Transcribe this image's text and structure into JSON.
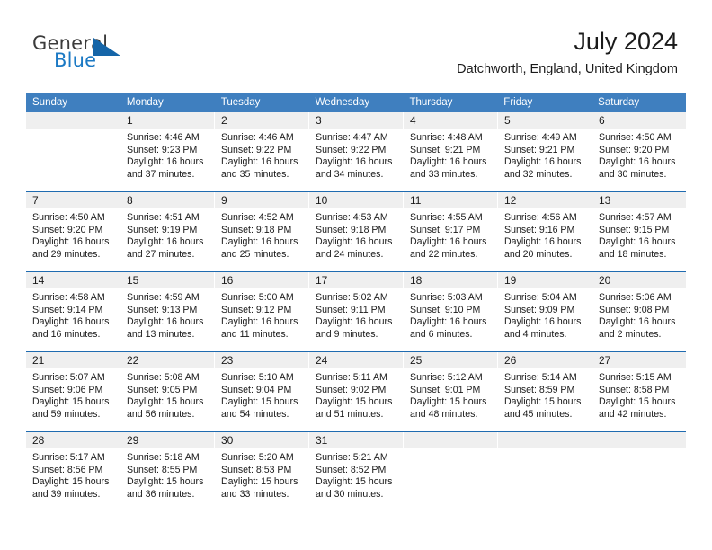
{
  "brand": {
    "name_part1": "General",
    "name_part2": "Blue",
    "accent_color": "#1b79c4",
    "triangle_color": "#1565a8"
  },
  "header": {
    "month_title": "July 2024",
    "location": "Datchworth, England, United Kingdom"
  },
  "theme": {
    "header_blue": "#3f7fbf",
    "separator_blue": "#1f6bb0",
    "day_band_gray": "#efefef"
  },
  "weekdays": [
    "Sunday",
    "Monday",
    "Tuesday",
    "Wednesday",
    "Thursday",
    "Friday",
    "Saturday"
  ],
  "weeks": [
    [
      {
        "day": "",
        "lines": []
      },
      {
        "day": "1",
        "lines": [
          "Sunrise: 4:46 AM",
          "Sunset: 9:23 PM",
          "Daylight: 16 hours",
          "and 37 minutes."
        ]
      },
      {
        "day": "2",
        "lines": [
          "Sunrise: 4:46 AM",
          "Sunset: 9:22 PM",
          "Daylight: 16 hours",
          "and 35 minutes."
        ]
      },
      {
        "day": "3",
        "lines": [
          "Sunrise: 4:47 AM",
          "Sunset: 9:22 PM",
          "Daylight: 16 hours",
          "and 34 minutes."
        ]
      },
      {
        "day": "4",
        "lines": [
          "Sunrise: 4:48 AM",
          "Sunset: 9:21 PM",
          "Daylight: 16 hours",
          "and 33 minutes."
        ]
      },
      {
        "day": "5",
        "lines": [
          "Sunrise: 4:49 AM",
          "Sunset: 9:21 PM",
          "Daylight: 16 hours",
          "and 32 minutes."
        ]
      },
      {
        "day": "6",
        "lines": [
          "Sunrise: 4:50 AM",
          "Sunset: 9:20 PM",
          "Daylight: 16 hours",
          "and 30 minutes."
        ]
      }
    ],
    [
      {
        "day": "7",
        "lines": [
          "Sunrise: 4:50 AM",
          "Sunset: 9:20 PM",
          "Daylight: 16 hours",
          "and 29 minutes."
        ]
      },
      {
        "day": "8",
        "lines": [
          "Sunrise: 4:51 AM",
          "Sunset: 9:19 PM",
          "Daylight: 16 hours",
          "and 27 minutes."
        ]
      },
      {
        "day": "9",
        "lines": [
          "Sunrise: 4:52 AM",
          "Sunset: 9:18 PM",
          "Daylight: 16 hours",
          "and 25 minutes."
        ]
      },
      {
        "day": "10",
        "lines": [
          "Sunrise: 4:53 AM",
          "Sunset: 9:18 PM",
          "Daylight: 16 hours",
          "and 24 minutes."
        ]
      },
      {
        "day": "11",
        "lines": [
          "Sunrise: 4:55 AM",
          "Sunset: 9:17 PM",
          "Daylight: 16 hours",
          "and 22 minutes."
        ]
      },
      {
        "day": "12",
        "lines": [
          "Sunrise: 4:56 AM",
          "Sunset: 9:16 PM",
          "Daylight: 16 hours",
          "and 20 minutes."
        ]
      },
      {
        "day": "13",
        "lines": [
          "Sunrise: 4:57 AM",
          "Sunset: 9:15 PM",
          "Daylight: 16 hours",
          "and 18 minutes."
        ]
      }
    ],
    [
      {
        "day": "14",
        "lines": [
          "Sunrise: 4:58 AM",
          "Sunset: 9:14 PM",
          "Daylight: 16 hours",
          "and 16 minutes."
        ]
      },
      {
        "day": "15",
        "lines": [
          "Sunrise: 4:59 AM",
          "Sunset: 9:13 PM",
          "Daylight: 16 hours",
          "and 13 minutes."
        ]
      },
      {
        "day": "16",
        "lines": [
          "Sunrise: 5:00 AM",
          "Sunset: 9:12 PM",
          "Daylight: 16 hours",
          "and 11 minutes."
        ]
      },
      {
        "day": "17",
        "lines": [
          "Sunrise: 5:02 AM",
          "Sunset: 9:11 PM",
          "Daylight: 16 hours",
          "and 9 minutes."
        ]
      },
      {
        "day": "18",
        "lines": [
          "Sunrise: 5:03 AM",
          "Sunset: 9:10 PM",
          "Daylight: 16 hours",
          "and 6 minutes."
        ]
      },
      {
        "day": "19",
        "lines": [
          "Sunrise: 5:04 AM",
          "Sunset: 9:09 PM",
          "Daylight: 16 hours",
          "and 4 minutes."
        ]
      },
      {
        "day": "20",
        "lines": [
          "Sunrise: 5:06 AM",
          "Sunset: 9:08 PM",
          "Daylight: 16 hours",
          "and 2 minutes."
        ]
      }
    ],
    [
      {
        "day": "21",
        "lines": [
          "Sunrise: 5:07 AM",
          "Sunset: 9:06 PM",
          "Daylight: 15 hours",
          "and 59 minutes."
        ]
      },
      {
        "day": "22",
        "lines": [
          "Sunrise: 5:08 AM",
          "Sunset: 9:05 PM",
          "Daylight: 15 hours",
          "and 56 minutes."
        ]
      },
      {
        "day": "23",
        "lines": [
          "Sunrise: 5:10 AM",
          "Sunset: 9:04 PM",
          "Daylight: 15 hours",
          "and 54 minutes."
        ]
      },
      {
        "day": "24",
        "lines": [
          "Sunrise: 5:11 AM",
          "Sunset: 9:02 PM",
          "Daylight: 15 hours",
          "and 51 minutes."
        ]
      },
      {
        "day": "25",
        "lines": [
          "Sunrise: 5:12 AM",
          "Sunset: 9:01 PM",
          "Daylight: 15 hours",
          "and 48 minutes."
        ]
      },
      {
        "day": "26",
        "lines": [
          "Sunrise: 5:14 AM",
          "Sunset: 8:59 PM",
          "Daylight: 15 hours",
          "and 45 minutes."
        ]
      },
      {
        "day": "27",
        "lines": [
          "Sunrise: 5:15 AM",
          "Sunset: 8:58 PM",
          "Daylight: 15 hours",
          "and 42 minutes."
        ]
      }
    ],
    [
      {
        "day": "28",
        "lines": [
          "Sunrise: 5:17 AM",
          "Sunset: 8:56 PM",
          "Daylight: 15 hours",
          "and 39 minutes."
        ]
      },
      {
        "day": "29",
        "lines": [
          "Sunrise: 5:18 AM",
          "Sunset: 8:55 PM",
          "Daylight: 15 hours",
          "and 36 minutes."
        ]
      },
      {
        "day": "30",
        "lines": [
          "Sunrise: 5:20 AM",
          "Sunset: 8:53 PM",
          "Daylight: 15 hours",
          "and 33 minutes."
        ]
      },
      {
        "day": "31",
        "lines": [
          "Sunrise: 5:21 AM",
          "Sunset: 8:52 PM",
          "Daylight: 15 hours",
          "and 30 minutes."
        ]
      },
      {
        "day": "",
        "lines": []
      },
      {
        "day": "",
        "lines": []
      },
      {
        "day": "",
        "lines": []
      }
    ]
  ]
}
